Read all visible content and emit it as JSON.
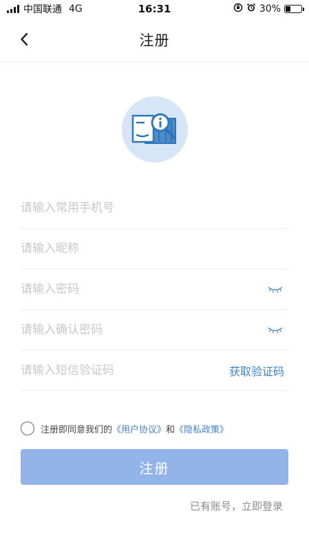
{
  "status_bar": {
    "carrier": "中国联通",
    "network": "4G",
    "time": "16:31",
    "battery": "30%",
    "battery_level": 0.3
  },
  "nav": {
    "title": "注册",
    "back_icon": "chevron-left-icon"
  },
  "logo": {
    "icon": "info-magnifier-icon",
    "bg_color": "#d6e6f6",
    "accent_color": "#2f76b8"
  },
  "form": {
    "phone_placeholder": "请输入常用手机号",
    "nickname_placeholder": "请输入昵称",
    "password_placeholder": "请输入密码",
    "confirm_password_placeholder": "请输入确认密码",
    "sms_code_placeholder": "请输入短信验证码",
    "get_code_label": "获取验证码",
    "eye_icon": "eye-closed-icon"
  },
  "agreement": {
    "prefix": "注册即同意我们的",
    "user_agreement": "《用户协议》",
    "connector": "和",
    "privacy_policy": "《隐私政策》"
  },
  "submit_label": "注册",
  "login_link": "已有账号，立即登录",
  "colors": {
    "link": "#3f83c8",
    "button_bg": "#93b4e9",
    "placeholder": "#c8c8c8",
    "divider": "#ececec"
  }
}
